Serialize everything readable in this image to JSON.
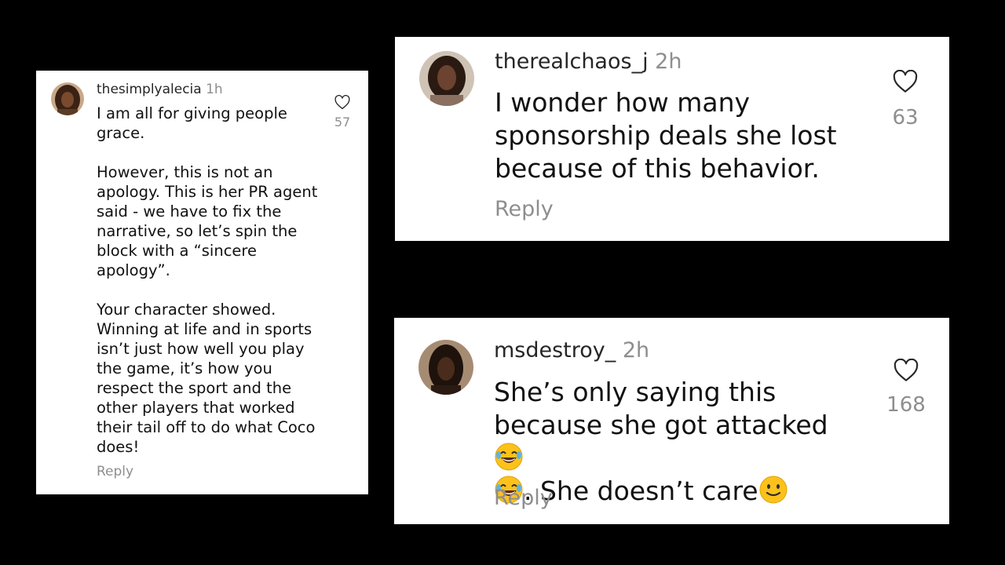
{
  "comments": [
    {
      "username": "thesimplyalecia",
      "time": "1h",
      "text": "I am all for giving people grace.\n\nHowever, this is not an apology. This is her PR agent said - we have to fix the narrative, so let’s spin the block with a “sincere apology”.\n\nYour character showed. Winning at life and in sports isn’t just how well you play the game, it’s how you respect the sport and the other players that worked their tail off to do what Coco does!",
      "likes": "57",
      "reply_label": "Reply",
      "avatar_color": "#7a4a2e"
    },
    {
      "username": "therealchaos_j",
      "time": "2h",
      "text": "I wonder how many sponsorship deals she lost because of this behavior.",
      "likes": "63",
      "reply_label": "Reply",
      "avatar_color": "#5a3a2a"
    },
    {
      "username": "msdestroy_",
      "time": "2h",
      "text_part1": "She’s only saying this because she got attacked",
      "text_part2": ". She doesn’t care",
      "likes": "168",
      "reply_label": "Reply",
      "avatar_color": "#3d2417"
    }
  ],
  "colors": {
    "background": "#000000",
    "card": "#ffffff",
    "muted": "#8e8e8e",
    "text": "#111111"
  },
  "icons": [
    "heart-outline-icon",
    "laughing-tears-emoji",
    "smiling-emoji"
  ]
}
